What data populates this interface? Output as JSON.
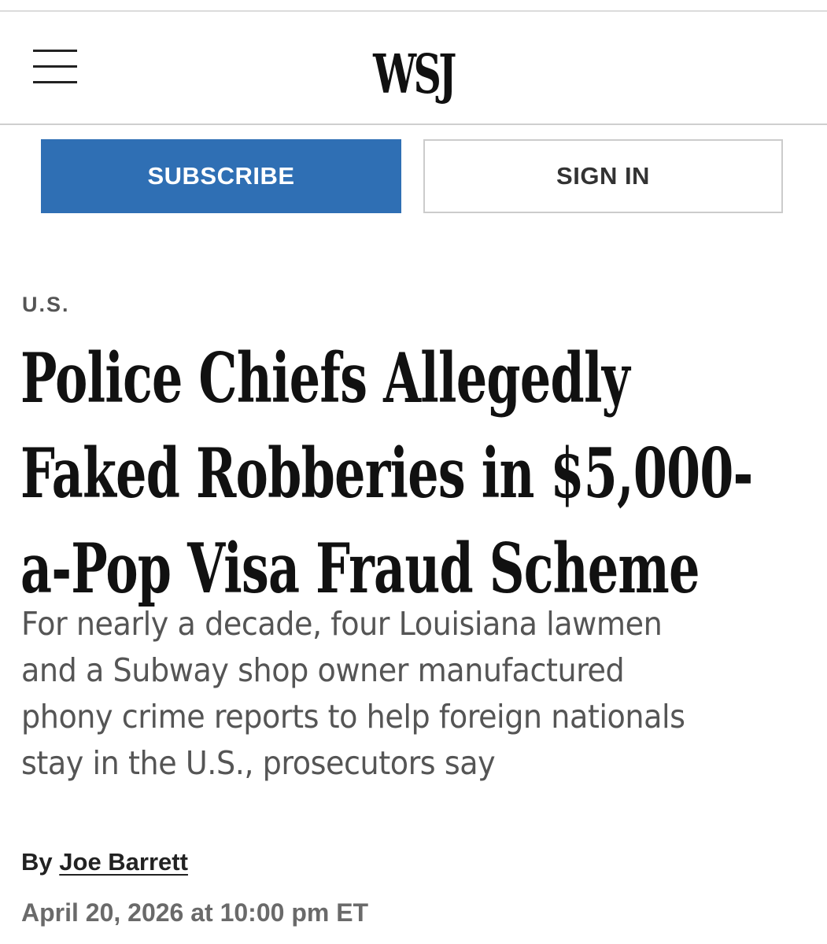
{
  "header": {
    "logo": "WSJ",
    "menu_icon": "hamburger-menu-icon"
  },
  "auth": {
    "subscribe_label": "SUBSCRIBE",
    "signin_label": "SIGN IN"
  },
  "article": {
    "section": "U.S.",
    "headline": "Police Chiefs Allegedly\nFaked Robberies in $5,000-\na-Pop Visa Fraud Scheme",
    "dek": "For nearly a decade, four Louisiana lawmen\nand a Subway shop owner manufactured\nphony crime reports to help foreign nationals\nstay in the U.S., prosecutors say",
    "byline_prefix": "By",
    "author": "Joe Barrett",
    "timestamp": "April 20, 2026 at 10:00 pm ET"
  },
  "colors": {
    "subscribe_bg": "#2f6fb4",
    "text_dark": "#111111",
    "text_gray": "#555555"
  }
}
